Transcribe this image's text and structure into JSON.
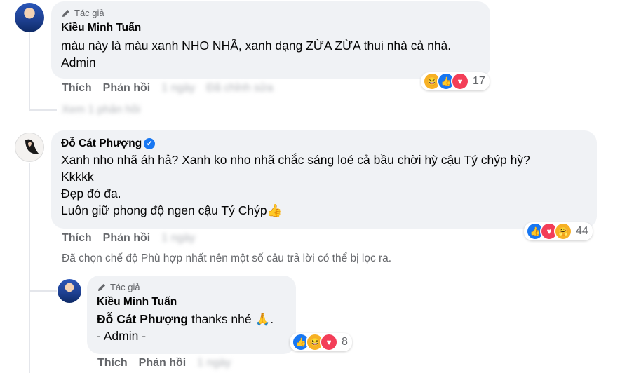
{
  "comments": [
    {
      "badge": "Tác giả",
      "author": "Kiều Minh Tuấn",
      "lines": [
        "màu này là màu xanh NHO NHÃ, xanh dạng ZỪA ZỪA thui nhà cả nhà.",
        "Admin"
      ],
      "like_label": "Thích",
      "reply_label": "Phản hồi",
      "reactions": [
        "haha",
        "like",
        "love"
      ],
      "reaction_count": "17"
    },
    {
      "author": "Đỗ Cát Phượng",
      "verified": true,
      "lines": [
        "Xanh nho nhã áh hả? Xanh ko nho nhã chắc sáng loé cả bầu chời hỳ cậu Tý chýp hỳ?",
        "Kkkkk",
        "Đẹp đó đa.",
        "Luôn giữ phong độ ngen cậu Tý Chýp👍"
      ],
      "like_label": "Thích",
      "reply_label": "Phản hồi",
      "reactions": [
        "like",
        "love",
        "care"
      ],
      "reaction_count": "44"
    }
  ],
  "filter_note": "Đã chọn chế độ Phù hợp nhất nên một số câu trả lời có thể bị lọc ra.",
  "reply": {
    "badge": "Tác giả",
    "author": "Kiều Minh Tuấn",
    "mention": "Đỗ Cát Phượng",
    "text_after_mention": " thanks nhé 🙏.",
    "line2": "- Admin -",
    "like_label": "Thích",
    "reply_label": "Phản hồi",
    "reactions": [
      "like",
      "haha",
      "love"
    ],
    "reaction_count": "8"
  },
  "colors": {
    "bubble": "#f0f2f5",
    "secondary_text": "#65676b",
    "like_blue": "#1877f2",
    "love_red": "#f33e58",
    "haha_yellow": "#f7b125"
  }
}
